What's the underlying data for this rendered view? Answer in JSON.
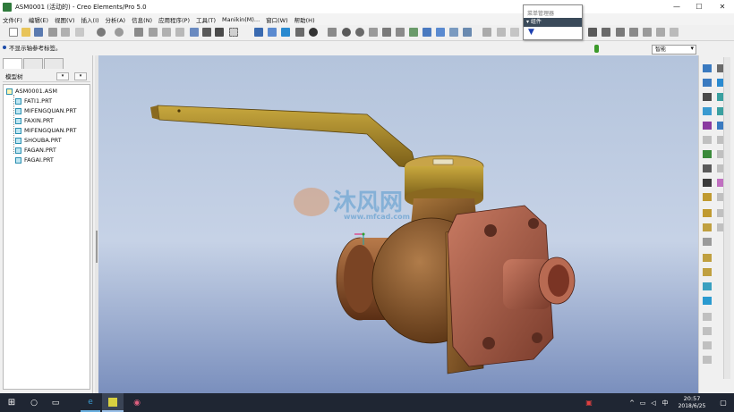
{
  "window": {
    "title": "ASM0001 (活动的) - Creo Elements/Pro 5.0"
  },
  "menu": [
    "文件(F)",
    "编辑(E)",
    "视图(V)",
    "插入(I)",
    "分析(A)",
    "信息(N)",
    "应用程序(P)",
    "工具(T)",
    "Manikin(M)...",
    "窗口(W)",
    "帮助(H)"
  ],
  "status": {
    "message": "不显示轴参考标签。"
  },
  "filter": {
    "value": "智能"
  },
  "menu_manager": {
    "title": "菜单管理器",
    "item": "组件"
  },
  "model_tree": {
    "header": "模型树",
    "items": [
      {
        "label": "ASM0001.ASM",
        "type": "assembly"
      },
      {
        "label": "FATI1.PRT",
        "type": "part"
      },
      {
        "label": "MIFENGQUAN.PRT",
        "type": "part"
      },
      {
        "label": "FAXIN.PRT",
        "type": "part"
      },
      {
        "label": "MIFENGQUAN.PRT",
        "type": "part"
      },
      {
        "label": "SHOUBA.PRT",
        "type": "part"
      },
      {
        "label": "FAGAN.PRT",
        "type": "part"
      },
      {
        "label": "FAGAI.PRT",
        "type": "part"
      }
    ]
  },
  "viewport": {
    "watermark": "沐风网",
    "watermark_url": "www.mfcad.com"
  },
  "taskbar": {
    "time": "20:57",
    "date": "2018/6/25",
    "ime": "中"
  },
  "colors": {
    "handle": "#a88a2a",
    "body_bronze": "#8c5a2e",
    "flange_copper": "#a85e4a",
    "viewport_top": "#b4c4dc",
    "viewport_bottom": "#7a8fbd",
    "taskbar": "#1f2633"
  }
}
